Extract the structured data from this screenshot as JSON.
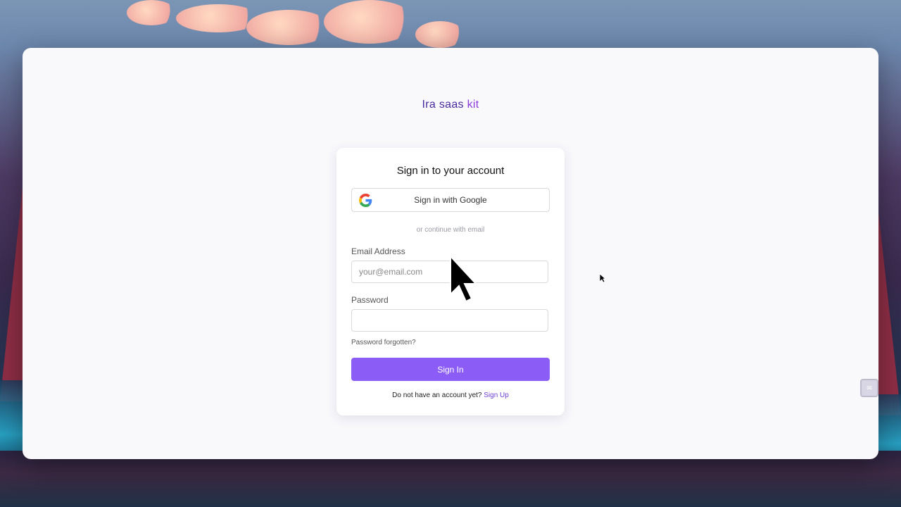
{
  "brand": {
    "part1": "Ira saas ",
    "part2": "kit"
  },
  "card": {
    "title": "Sign in to your account",
    "google_button": "Sign in with Google",
    "divider": "or continue with email",
    "email_label": "Email Address",
    "email_placeholder": "your@email.com",
    "email_value": "",
    "password_label": "Password",
    "password_value": "",
    "forgot_link": "Password forgotten?",
    "signin_button": "Sign In",
    "footer_text": "Do not have an account yet? ",
    "footer_link": "Sign Up"
  },
  "colors": {
    "accent": "#8b5cf6",
    "brand_dark": "#4a2aa0",
    "brand_light": "#8b3bdc"
  },
  "icons": {
    "google": "google-icon",
    "cursor": "mouse-pointer-icon",
    "widget": "mail-icon"
  },
  "side_widget": {
    "glyph": "✉"
  }
}
